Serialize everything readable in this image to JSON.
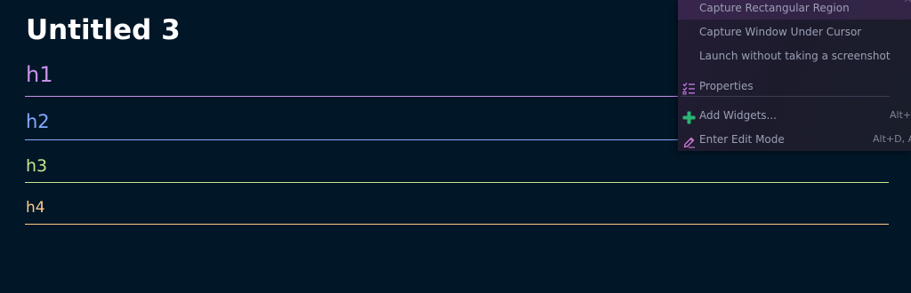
{
  "document": {
    "title": "Untitled 3",
    "headings": [
      {
        "level": "h1",
        "text": "h1",
        "color": "#c792ea"
      },
      {
        "level": "h2",
        "text": "h2",
        "color": "#82aaff"
      },
      {
        "level": "h3",
        "text": "h3",
        "color": "#c3e88d"
      },
      {
        "level": "h4",
        "text": "h4",
        "color": "#ffcb8b"
      }
    ]
  },
  "context_menu": {
    "items": [
      {
        "label": "Capture Rectangular Region",
        "highlighted": true
      },
      {
        "label": "Capture Window Under Cursor"
      },
      {
        "label": "Launch without taking a screenshot"
      },
      {
        "label": "Properties",
        "icon": "properties-checklist-icon"
      },
      {
        "label": "Add Widgets...",
        "shortcut": "Alt+D",
        "icon": "add-plus-icon"
      },
      {
        "label": "Enter Edit Mode",
        "shortcut": "Alt+D, Al",
        "icon": "edit-pencil-icon"
      }
    ],
    "corner_shortcut": "A"
  },
  "colors": {
    "background": "#011627",
    "title": "#ffffff",
    "menu_text": "#9aa0b4",
    "menu_highlight": "#4b2d5f",
    "add_icon": "#2bb673",
    "properties_icon": "#c97ce8",
    "edit_icon": "#d47bd8"
  }
}
